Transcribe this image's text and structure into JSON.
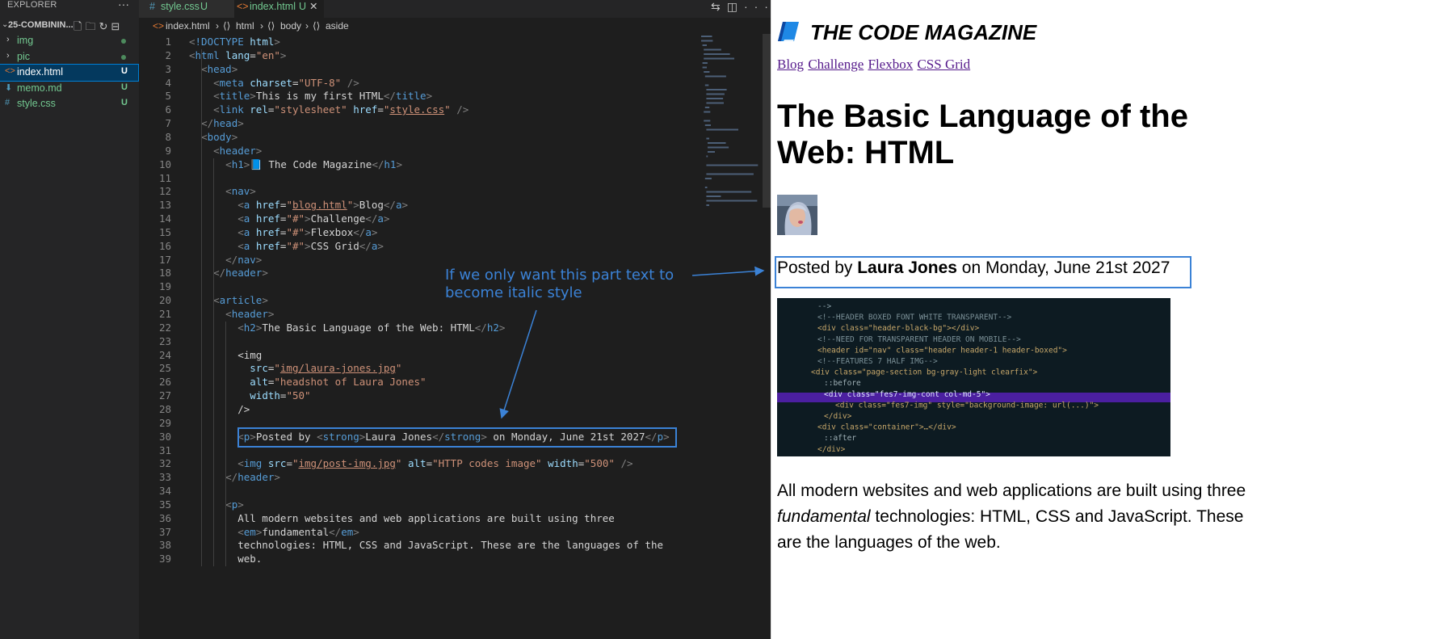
{
  "sidebar": {
    "title": "EXPLORER",
    "folder": "25-COMBININ...",
    "items": [
      {
        "label": "img",
        "type": "folder"
      },
      {
        "label": "pic",
        "type": "folder"
      },
      {
        "label": "index.html",
        "type": "file",
        "status": "U",
        "selected": true
      },
      {
        "label": "memo.md",
        "type": "file",
        "status": "U"
      },
      {
        "label": "style.css",
        "type": "file",
        "status": "U"
      }
    ]
  },
  "tabs": [
    {
      "icon": "#",
      "label": "style.css",
      "status": "U"
    },
    {
      "icon": "<>",
      "label": "index.html",
      "status": "U",
      "active": true
    }
  ],
  "breadcrumb": [
    "index.html",
    "html",
    "body",
    "aside"
  ],
  "code_lines": [
    "<!DOCTYPE html>",
    "<html lang=\"en\">",
    "  <head>",
    "    <meta charset=\"UTF-8\" />",
    "    <title>This is my first HTML</title>",
    "    <link rel=\"stylesheet\" href=\"style.css\" />",
    "  </head>",
    "  <body>",
    "    <header>",
    "      <h1>📘 The Code Magazine</h1>",
    "",
    "      <nav>",
    "        <a href=\"blog.html\">Blog</a>",
    "        <a href=\"#\">Challenge</a>",
    "        <a href=\"#\">Flexbox</a>",
    "        <a href=\"#\">CSS Grid</a>",
    "      </nav>",
    "    </header>",
    "",
    "    <article>",
    "      <header>",
    "        <h2>The Basic Language of the Web: HTML</h2>",
    "",
    "        <img",
    "          src=\"img/laura-jones.jpg\"",
    "          alt=\"headshot of Laura Jones\"",
    "          width=\"50\"",
    "        />",
    "",
    "        <p>Posted by <strong>Laura Jones</strong> on Monday, June 21st 2027</p>",
    "",
    "        <img src=\"img/post-img.jpg\" alt=\"HTTP codes image\" width=\"500\" />",
    "      </header>",
    "",
    "      <p>",
    "        All modern websites and web applications are built using three",
    "        <em>fundamental</em>",
    "        technologies: HTML, CSS and JavaScript. These are the languages of the",
    "        web."
  ],
  "annotation": {
    "line1": "If we only want this part text to",
    "line2": "become italic style"
  },
  "preview": {
    "brand": "THE CODE MAGAZINE",
    "nav": [
      "Blog",
      "Challenge",
      "Flexbox",
      "CSS Grid"
    ],
    "article_title": "The Basic Language of the Web: HTML",
    "byline": {
      "prefix": "Posted by ",
      "author": "Laura Jones",
      "suffix": " on Monday, June 21st 2027"
    },
    "paragraph": {
      "before": "All modern websites and web applications are built using three ",
      "em": "fundamental",
      "after": " technologies: HTML, CSS and JavaScript. These are the languages of the web."
    },
    "post_image_code": [
      "-->",
      "<!--HEADER BOXED FONT WHITE TRANSPARENT-->",
      "<div class=\"header-black-bg\"></div>",
      "<!--NEED FOR TRANSPARENT HEADER ON MOBILE-->",
      "<header id=\"nav\" class=\"header header-1 header-boxed\">",
      "<!--FEATURES 7 HALF IMG-->",
      "<div class=\"page-section bg-gray-light clearfix\">",
      "::before",
      "<div class=\"fes7-img-cont col-md-5\">",
      "<div class=\"fes7-img\" style=\"background-image: url(...)\">",
      "</div>",
      "<div class=\"container\">…</div>",
      "::after",
      "</div>"
    ]
  },
  "colors": {
    "accent": "#3b82d6",
    "tag": "#569cd6",
    "attr": "#9cdcfe",
    "string": "#ce9178",
    "untracked": "#73c991",
    "link": "#551a8b"
  }
}
